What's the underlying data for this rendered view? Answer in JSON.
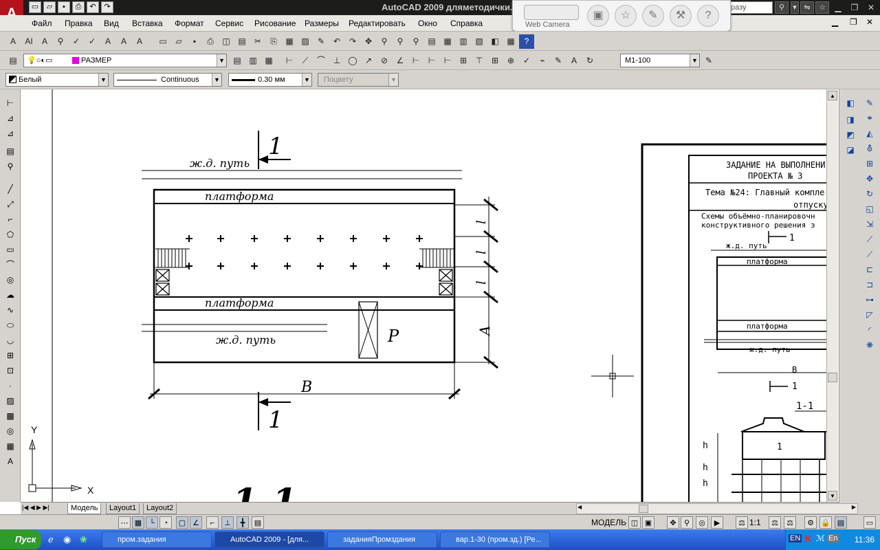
{
  "window": {
    "title": "AutoCAD 2009 дляметодички.dwg",
    "search_placeholder": "разу"
  },
  "webcam": {
    "label": "Web Camera"
  },
  "menu": [
    "Файл",
    "Правка",
    "Вид",
    "Вставка",
    "Формат",
    "Сервис",
    "Рисование",
    "Размеры",
    "Редактировать",
    "Окно",
    "Справка"
  ],
  "layers": {
    "current_layer": "РАЗМЕР",
    "dimstyle": "M1-100"
  },
  "properties": {
    "color": "Белый",
    "linetype": "Continuous",
    "lineweight": "0.30 мм",
    "plotstyle": "Поцвету"
  },
  "drawing": {
    "track_top": "ж.д. путь",
    "platform_top": "платформа",
    "platform_bottom": "платформа",
    "track_bottom": "ж.д. путь",
    "label_b": "B",
    "label_a": "A",
    "label_p": "P",
    "section_mark": "1",
    "section_title": "1-1",
    "dim_l": "l",
    "ref_title1": "ЗАДАНИЕ НА ВЫПОЛНЕНИ",
    "ref_title2": "ПРОЕКТА № 3",
    "ref_theme1": "Тема №24: Главный компле",
    "ref_theme2": "отпуску",
    "ref_scheme1": "Схемы объёмно-планировочн",
    "ref_scheme2": "конструктивного решения з",
    "ref_one": "1",
    "ref_track": "ж.д. путь",
    "ref_platform": "платформа",
    "ref_platform2": "платформа",
    "ref_track2": "ж.д. путь",
    "ref_b": "B",
    "ref_one2": "1",
    "ref_section": "1-1",
    "ref_h3": "h",
    "ref_h2": "h",
    "ref_h1": "h",
    "ref_num": "1",
    "axis_x": "X",
    "axis_y": "Y"
  },
  "tabs": [
    "Модель",
    "Layout1",
    "Layout2"
  ],
  "status": {
    "model": "МОДЕЛЬ",
    "scale": "1:1"
  },
  "taskbar": {
    "start": "Пуск",
    "tasks": [
      "пром.задания",
      "AutoCAD 2009 - [для...",
      "заданияПромздания",
      "вар.1-30 (пром.зд.) [Ре..."
    ],
    "lang": "EN",
    "lang2": "En",
    "clock": "11:36"
  }
}
